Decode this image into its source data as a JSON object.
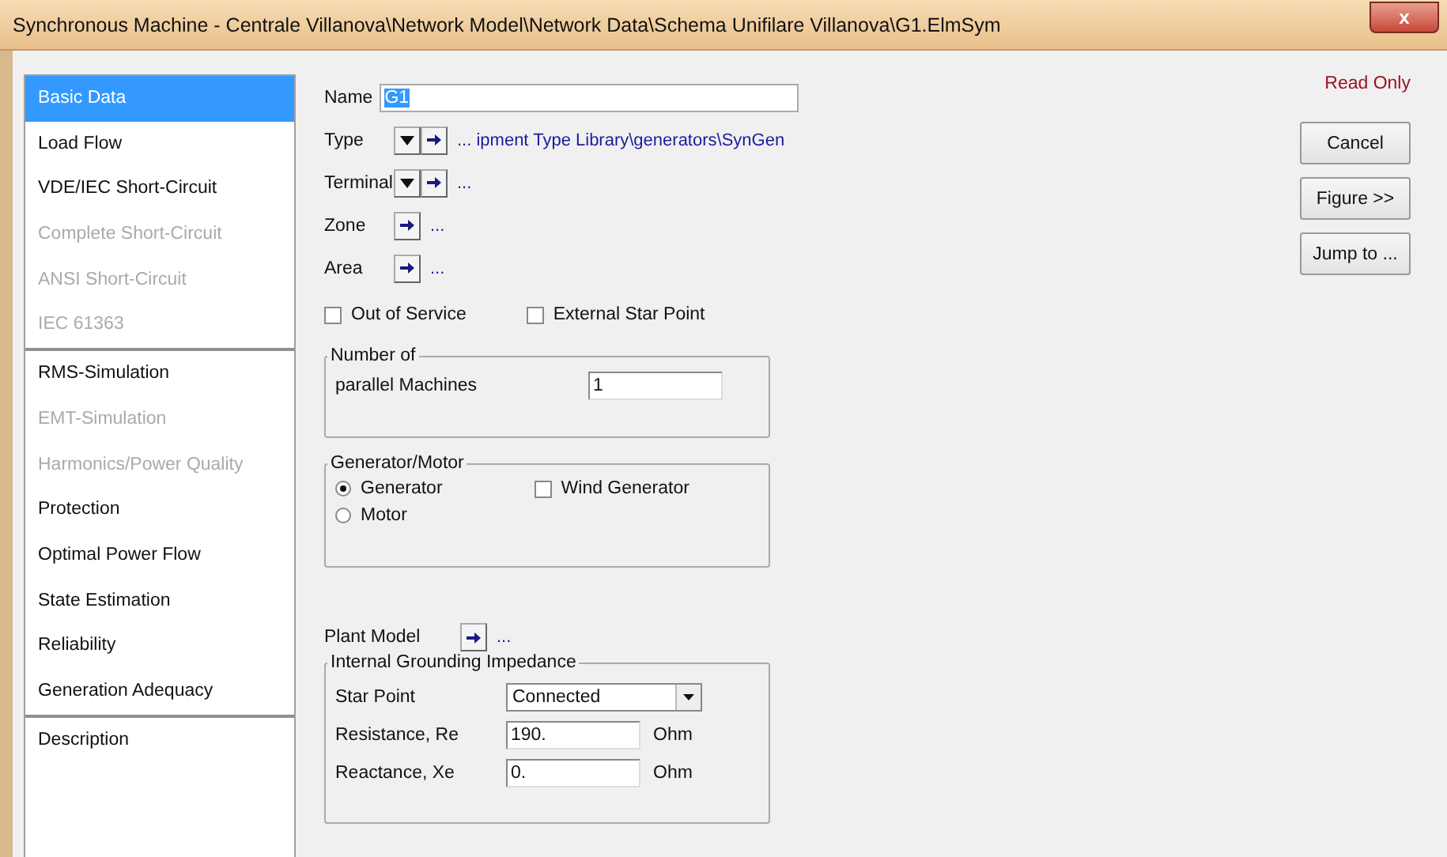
{
  "window": {
    "title": "Synchronous Machine - Centrale Villanova\\Network Model\\Network Data\\Schema Unifilare Villanova\\G1.ElmSym",
    "close": "x"
  },
  "sidebar": {
    "groups": [
      {
        "items": [
          {
            "label": "Basic Data",
            "selected": true,
            "disabled": false
          },
          {
            "label": "Load Flow",
            "selected": false,
            "disabled": false
          },
          {
            "label": "VDE/IEC Short-Circuit",
            "selected": false,
            "disabled": false
          },
          {
            "label": "Complete Short-Circuit",
            "selected": false,
            "disabled": true
          },
          {
            "label": "ANSI Short-Circuit",
            "selected": false,
            "disabled": true
          },
          {
            "label": "IEC 61363",
            "selected": false,
            "disabled": true
          }
        ]
      },
      {
        "items": [
          {
            "label": "RMS-Simulation",
            "selected": false,
            "disabled": false
          },
          {
            "label": "EMT-Simulation",
            "selected": false,
            "disabled": true
          },
          {
            "label": "Harmonics/Power Quality",
            "selected": false,
            "disabled": true
          },
          {
            "label": "Protection",
            "selected": false,
            "disabled": false
          },
          {
            "label": "Optimal Power Flow",
            "selected": false,
            "disabled": false
          },
          {
            "label": "State Estimation",
            "selected": false,
            "disabled": false
          },
          {
            "label": "Reliability",
            "selected": false,
            "disabled": false
          },
          {
            "label": "Generation Adequacy",
            "selected": false,
            "disabled": false
          }
        ]
      },
      {
        "items": [
          {
            "label": "Description",
            "selected": false,
            "disabled": false
          }
        ]
      }
    ]
  },
  "name": {
    "label": "Name",
    "value": "G1"
  },
  "refs": [
    {
      "label": "Type",
      "kind": "select",
      "value": "... ipment Type Library\\generators\\SynGen"
    },
    {
      "label": "Terminal",
      "kind": "select",
      "value": "..."
    },
    {
      "label": "Zone",
      "kind": "jump",
      "value": "..."
    },
    {
      "label": "Area",
      "kind": "jump",
      "value": "..."
    }
  ],
  "flags": [
    {
      "label": "Out of Service",
      "checked": false
    },
    {
      "label": "External Star Point",
      "checked": false
    }
  ],
  "number_of": {
    "title": "Number of",
    "label": "parallel Machines",
    "value": "1"
  },
  "generator_motor": {
    "title": "Generator/Motor",
    "options": [
      {
        "label": "Generator",
        "selected": true
      },
      {
        "label": "Motor",
        "selected": false
      }
    ],
    "wind": {
      "label": "Wind Generator",
      "checked": false
    }
  },
  "plant_model": {
    "label": "Plant Model",
    "value": "..."
  },
  "grounding": {
    "title": "Internal Grounding Impedance",
    "star_point": {
      "label": "Star Point",
      "value": "Connected"
    },
    "fields": [
      {
        "label": "Resistance, Re",
        "value": "190.",
        "unit": "Ohm"
      },
      {
        "label": "Reactance, Xe",
        "value": "0.",
        "unit": "Ohm"
      }
    ]
  },
  "status": "Read Only",
  "buttons": [
    "Cancel",
    "Figure >>",
    "Jump to ..."
  ]
}
